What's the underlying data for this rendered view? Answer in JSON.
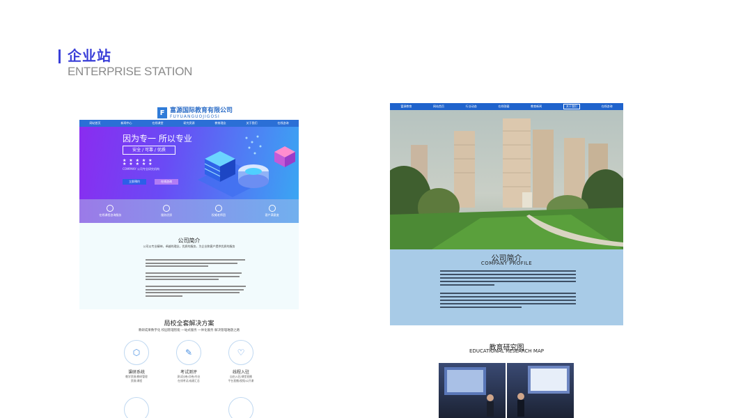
{
  "slide": {
    "title_cn": "企业站",
    "title_en": "ENTERPRISE STATION",
    "accent_color": "#3a3fd8"
  },
  "left_mock": {
    "logo_mark": "F",
    "logo_cn": "富源国际教育有限公司",
    "logo_en": "FUYUANGUOJIGOSI",
    "nav": [
      "网站首页",
      "新闻中心",
      "在线课堂",
      "研究资源",
      "教育理念",
      "关于我们",
      "在线咨询"
    ],
    "hero_heading": "因为专一  所以专业",
    "hero_box": "安全 / 可靠 / 优质",
    "hero_dots": "★ ★ ★ ★ ★\n★ ★ ★ ★ ★",
    "hero_small": "COMPANY 公司专业研究机构",
    "hero_btn1": "立即预约",
    "hero_btn2": "在线咨询",
    "stats": [
      {
        "label": "在线课程咨询服务"
      },
      {
        "label": "服务优质"
      },
      {
        "label": "权威老师团"
      },
      {
        "label": "客户满意度"
      }
    ],
    "about_title": "公司简介",
    "about_sub": "公司以专业精神，卓越的理念，优质的服务，为企业和客户提供优质的服务",
    "solutions_title": "局校全套解决方案",
    "solutions_sub": "教研成果数字化   校园管理智能   一站式服务   一体化服务   解决管理难题之路",
    "solutions": [
      {
        "icon": "⬡",
        "name": "课研系统",
        "desc": "教学资源/教研管理\n资源/课程"
      },
      {
        "icon": "✎",
        "name": "考试测评",
        "desc": "测试出卷/交卷/作业\n在线考试/成绩汇总"
      },
      {
        "icon": "♡",
        "name": "线程入驻",
        "desc": "自由入驻/课堂直播\n平台直播/视频/公开课"
      }
    ]
  },
  "right_mock": {
    "nav": [
      "富源教育",
      "网站首页",
      "行业动态",
      "在线答疑",
      "教育新闻",
      "关于我们",
      "在线咨询"
    ],
    "profile_cn": "公司简介",
    "profile_en": "COMPANY PROFILE",
    "map_cn": "教育研究图",
    "map_en": "EDUCATIONAL RESEARCH MAP"
  }
}
